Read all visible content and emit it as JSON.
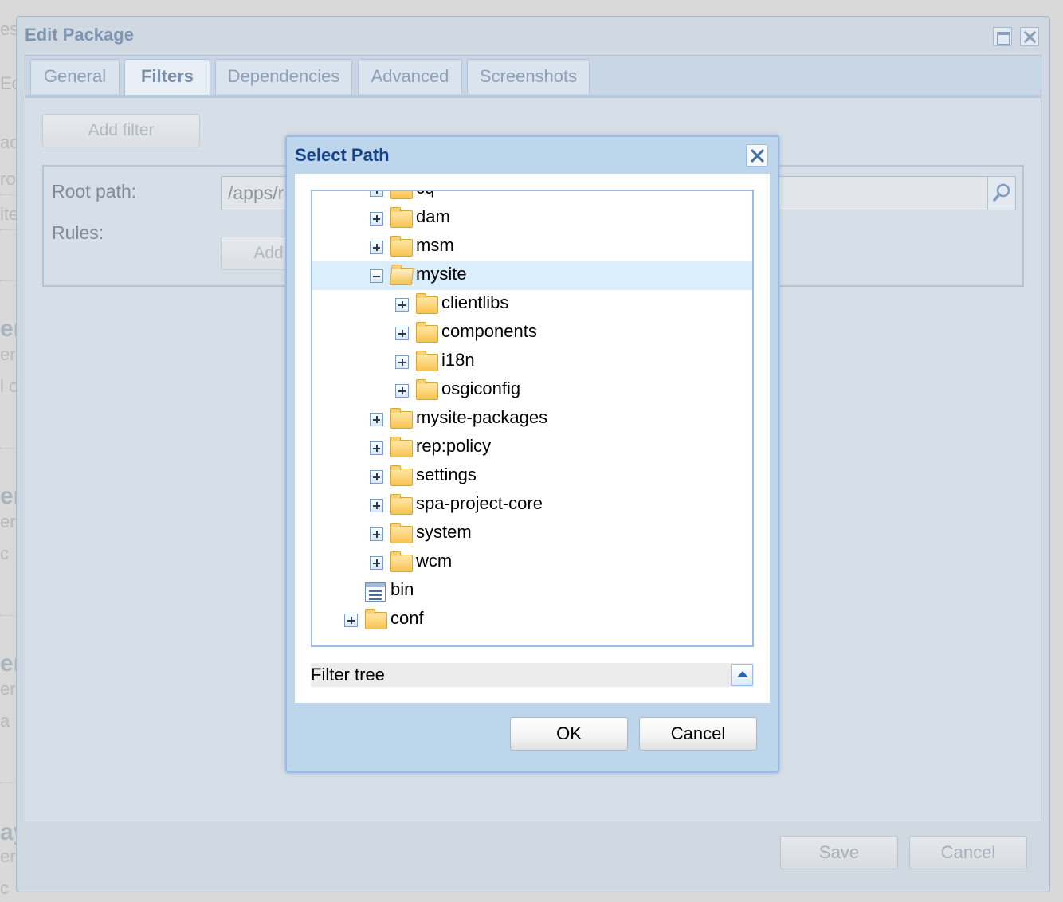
{
  "background": {
    "fragments": [
      "es",
      "Ed",
      "ac",
      "ro",
      "ite",
      "er",
      "ers",
      "l o",
      "er",
      "ers",
      "c",
      "er",
      "ers",
      "a",
      "ay",
      "ers",
      "c"
    ]
  },
  "edit_package": {
    "title": "Edit Package",
    "tabs": [
      {
        "label": "General"
      },
      {
        "label": "Filters"
      },
      {
        "label": "Dependencies"
      },
      {
        "label": "Advanced"
      },
      {
        "label": "Screenshots"
      }
    ],
    "active_tab": "Filters",
    "add_filter_label": "Add filter",
    "root_path_label": "Root path:",
    "root_path_value": "/apps/r",
    "rules_label": "Rules:",
    "add_rule_label": "Add",
    "save_label": "Save",
    "cancel_label": "Cancel"
  },
  "select_path": {
    "title": "Select Path",
    "tree": [
      {
        "label": "cq",
        "level": 2,
        "toggle": "plus",
        "icon": "folder-icon"
      },
      {
        "label": "dam",
        "level": 2,
        "toggle": "plus",
        "icon": "folder-icon"
      },
      {
        "label": "msm",
        "level": 2,
        "toggle": "plus",
        "icon": "folder-icon"
      },
      {
        "label": "mysite",
        "level": 2,
        "toggle": "minus",
        "icon": "folder-open-icon",
        "selected": true
      },
      {
        "label": "clientlibs",
        "level": 3,
        "toggle": "plus",
        "icon": "folder-icon"
      },
      {
        "label": "components",
        "level": 3,
        "toggle": "plus",
        "icon": "folder-icon"
      },
      {
        "label": "i18n",
        "level": 3,
        "toggle": "plus",
        "icon": "folder-icon"
      },
      {
        "label": "osgiconfig",
        "level": 3,
        "toggle": "plus",
        "icon": "folder-icon"
      },
      {
        "label": "mysite-packages",
        "level": 2,
        "toggle": "plus",
        "icon": "folder-icon"
      },
      {
        "label": "rep:policy",
        "level": 2,
        "toggle": "plus",
        "icon": "folder-icon"
      },
      {
        "label": "settings",
        "level": 2,
        "toggle": "plus",
        "icon": "folder-icon"
      },
      {
        "label": "spa-project-core",
        "level": 2,
        "toggle": "plus",
        "icon": "folder-icon"
      },
      {
        "label": "system",
        "level": 2,
        "toggle": "plus",
        "icon": "folder-icon"
      },
      {
        "label": "wcm",
        "level": 2,
        "toggle": "plus",
        "icon": "folder-icon"
      },
      {
        "label": "bin",
        "level": 1,
        "toggle": "none",
        "icon": "file-icon"
      },
      {
        "label": "conf",
        "level": 1,
        "toggle": "plus",
        "icon": "folder-icon"
      }
    ],
    "filter_label": "Filter tree",
    "ok_label": "OK",
    "cancel_label": "Cancel"
  }
}
